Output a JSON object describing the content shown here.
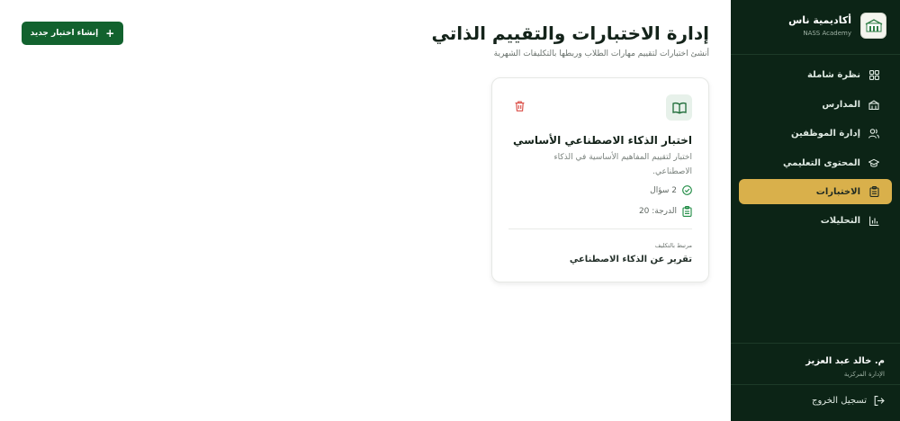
{
  "brand": {
    "name": "أكاديمية ناس",
    "subtitle": "NASS Academy"
  },
  "sidebar": {
    "items": [
      {
        "label": "نظرة شاملة",
        "icon": "grid-icon",
        "active": false
      },
      {
        "label": "المدارس",
        "icon": "school-icon",
        "active": false
      },
      {
        "label": "إدارة الموظفين",
        "icon": "users-icon",
        "active": false
      },
      {
        "label": "المحتوى التعليمي",
        "icon": "graduation-cap-icon",
        "active": false
      },
      {
        "label": "الاختبارات",
        "icon": "clipboard-icon",
        "active": true
      },
      {
        "label": "التحليلات",
        "icon": "bar-chart-icon",
        "active": false
      }
    ]
  },
  "user": {
    "name": "م. خالد عبد العزيز",
    "role": "الإدارة المركزية"
  },
  "logout_label": "تسجيل الخروج",
  "header": {
    "title": "إدارة الاختبارات والتقييم الذاتي",
    "subtitle": "أنشئ اختبارات لتقييم مهارات الطلاب وربطها بالتكليفات الشهرية",
    "create_button": "إنشاء اختبار جديد"
  },
  "quiz_card": {
    "title": "اختبار الذكاء الاصطناعي الأساسي",
    "description": "اختبار لتقييم المفاهيم الأساسية في الذكاء الاصطناعي.",
    "questions": "2 سؤال",
    "score": "الدرجة: 20",
    "linked_label": "مرتبط بالتكليف",
    "linked_assignment": "تقرير عن الذكاء الاصطناعي"
  },
  "colors": {
    "sidebar_bg": "#0c2416",
    "accent_gold": "#d9b04b",
    "primary_green": "#12622e",
    "danger": "#d9463e"
  }
}
